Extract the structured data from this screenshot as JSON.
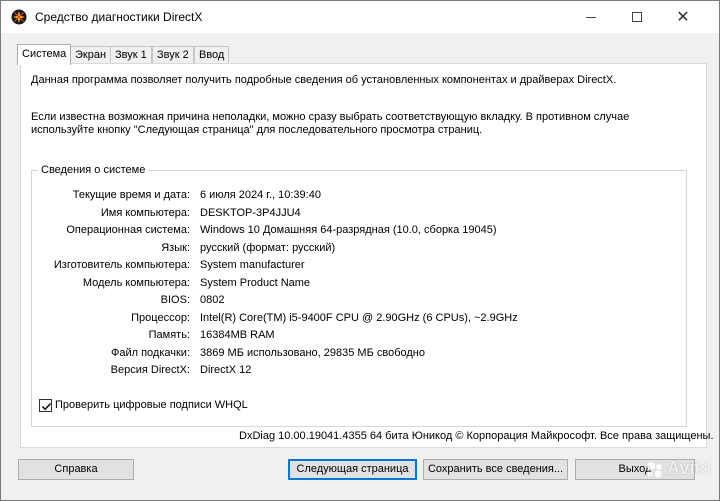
{
  "window": {
    "title": "Средство диагностики DirectX",
    "minimize_glyph": "",
    "maximize_glyph": "",
    "close_glyph": "✕"
  },
  "tabs": [
    {
      "label": "Система",
      "active": true
    },
    {
      "label": "Экран"
    },
    {
      "label": "Звук 1"
    },
    {
      "label": "Звук 2"
    },
    {
      "label": "Ввод"
    }
  ],
  "intro": {
    "line1": "Данная программа позволяет получить подробные сведения об установленных компонентах и драйверах DirectX.",
    "line2": "Если известна возможная причина неполадки, можно сразу выбрать соответствующую вкладку. В противном случае используйте кнопку \"Следующая страница\" для последовательного просмотра страниц."
  },
  "system_info": {
    "legend": "Сведения о системе",
    "rows": [
      {
        "label": "Текущие время и дата:",
        "value": "6 июля 2024 г., 10:39:40"
      },
      {
        "label": "Имя компьютера:",
        "value": "DESKTOP-3P4JJU4"
      },
      {
        "label": "Операционная система:",
        "value": "Windows 10 Домашняя 64-разрядная (10.0, сборка 19045)"
      },
      {
        "label": "Язык:",
        "value": "русский (формат: русский)"
      },
      {
        "label": "Изготовитель компьютера:",
        "value": "System manufacturer"
      },
      {
        "label": "Модель компьютера:",
        "value": "System Product Name"
      },
      {
        "label": "BIOS:",
        "value": "0802"
      },
      {
        "label": "Процессор:",
        "value": "Intel(R) Core(TM) i5-9400F CPU @ 2.90GHz (6 CPUs), ~2.9GHz"
      },
      {
        "label": "Память:",
        "value": "16384MB RAM"
      },
      {
        "label": "Файл подкачки:",
        "value": "3869 МБ использовано, 29835 МБ свободно"
      },
      {
        "label": "Версия DirectX:",
        "value": "DirectX 12"
      }
    ]
  },
  "whql": {
    "label": "Проверить цифровые подписи WHQL",
    "checked": true
  },
  "footer": {
    "copyright": "DxDiag 10.00.19041.4355 64 бита Юникод © Корпорация Майкрософт. Все права защищены."
  },
  "buttons": {
    "help": "Справка",
    "next": "Следующая страница",
    "save": "Сохранить все сведения...",
    "exit": "Выход"
  },
  "watermark": {
    "text": "Avito"
  },
  "colors": {
    "accent": "#0078d7",
    "window_bg": "#f0f0f0",
    "panel_bg": "#ffffff"
  }
}
